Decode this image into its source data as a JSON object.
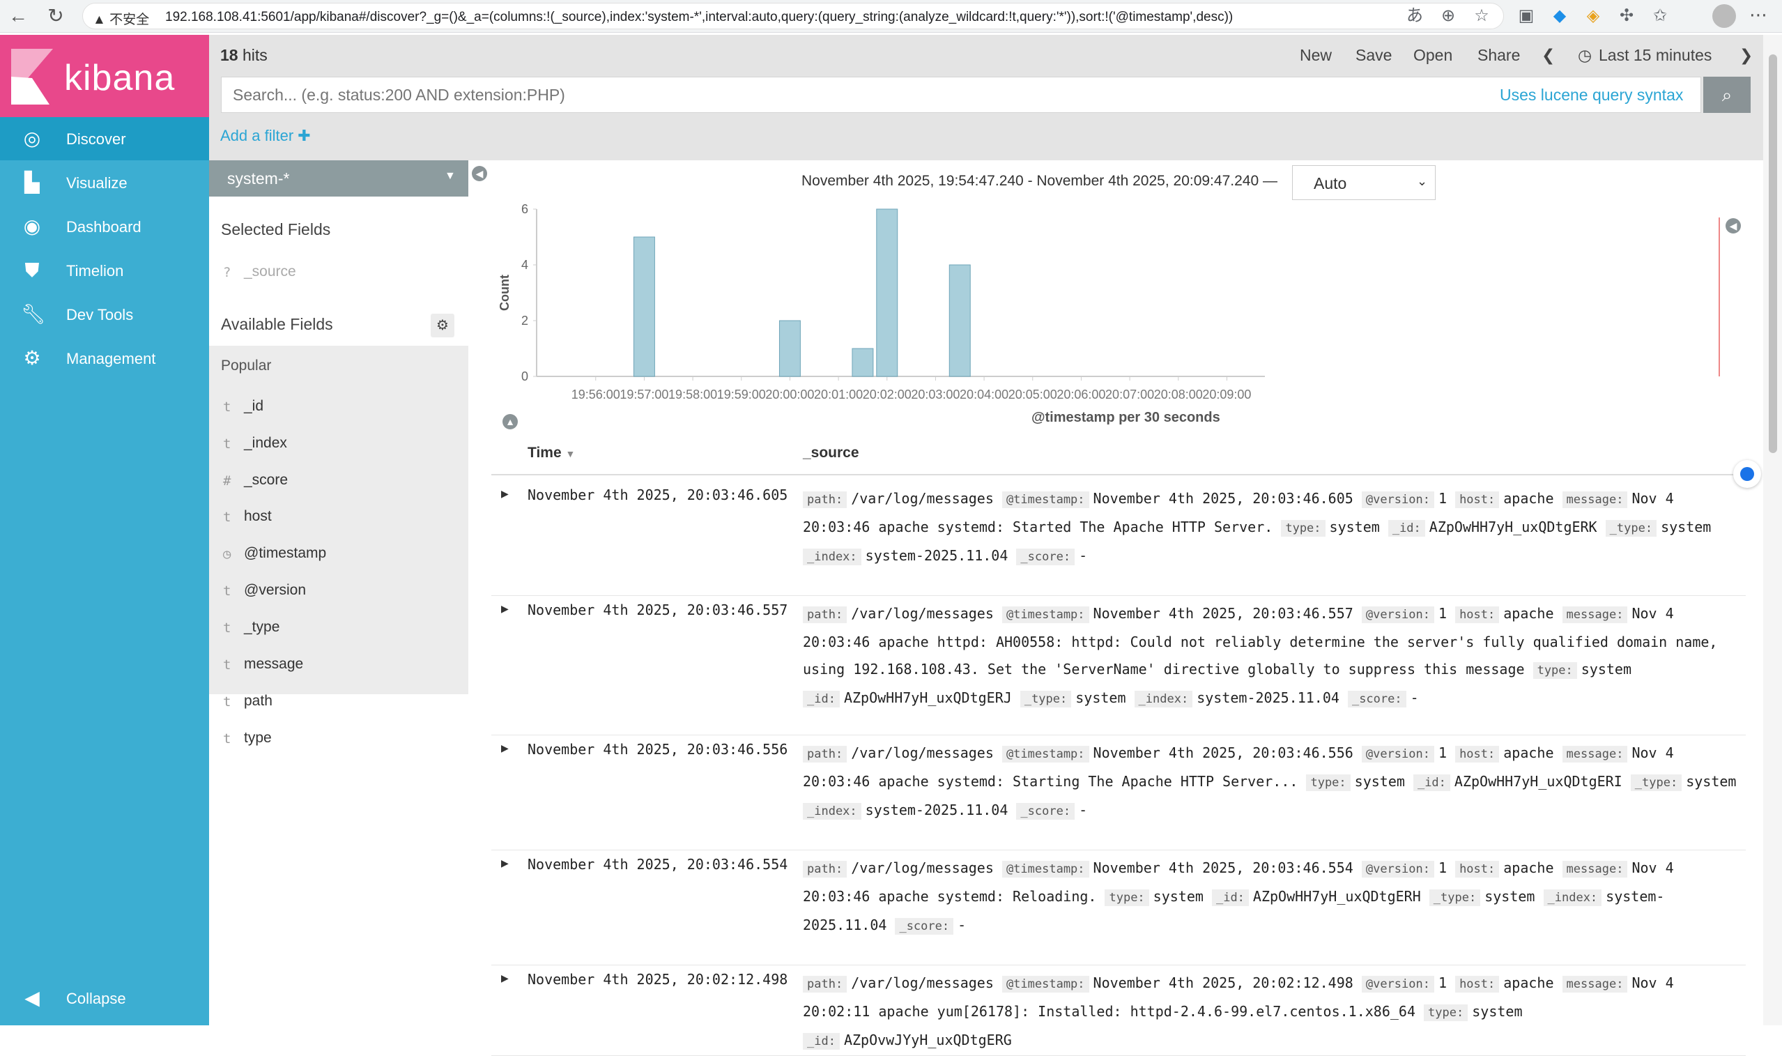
{
  "browser": {
    "insecure_label": "不安全",
    "url": "192.168.108.41:5601/app/kibana#/discover?_g=()&_a=(columns:!(_source),index:'system-*',interval:auto,query:(query_string:(analyze_wildcard:!t,query:'*')),sort:!('@timestamp',desc))"
  },
  "sidebar": {
    "brand": "kibana",
    "items": [
      {
        "label": "Discover",
        "icon": "compass-icon"
      },
      {
        "label": "Visualize",
        "icon": "bar-chart-icon"
      },
      {
        "label": "Dashboard",
        "icon": "dashboard-icon"
      },
      {
        "label": "Timelion",
        "icon": "shield-icon"
      },
      {
        "label": "Dev Tools",
        "icon": "wrench-icon"
      },
      {
        "label": "Management",
        "icon": "gear-icon"
      }
    ],
    "collapse": "Collapse"
  },
  "topbar": {
    "hits_count": "18",
    "hits_label": "hits",
    "new": "New",
    "save": "Save",
    "open": "Open",
    "share": "Share",
    "timepicker": "Last 15 minutes"
  },
  "search": {
    "placeholder": "Search... (e.g. status:200 AND extension:PHP)",
    "lucene_link": "Uses lucene query syntax"
  },
  "filter": {
    "add": "Add a filter"
  },
  "fields": {
    "index_pattern": "system-*",
    "selected_title": "Selected Fields",
    "selected": [
      {
        "type": "?",
        "name": "_source"
      }
    ],
    "available_title": "Available Fields",
    "popular_label": "Popular",
    "popular": [
      {
        "type": "t",
        "name": "_id"
      },
      {
        "type": "t",
        "name": "_index"
      },
      {
        "type": "#",
        "name": "_score"
      },
      {
        "type": "t",
        "name": "host"
      }
    ],
    "others": [
      {
        "type": "◷",
        "name": "@timestamp"
      },
      {
        "type": "t",
        "name": "@version"
      },
      {
        "type": "t",
        "name": "_type"
      },
      {
        "type": "t",
        "name": "message"
      },
      {
        "type": "t",
        "name": "path"
      },
      {
        "type": "t",
        "name": "type"
      }
    ]
  },
  "histogram": {
    "range_text": "November 4th 2025, 19:54:47.240 - November 4th 2025, 20:09:47.240 —",
    "interval": "Auto"
  },
  "chart_data": {
    "type": "bar",
    "ylabel": "Count",
    "xlabel": "@timestamp per 30 seconds",
    "ylim": [
      0,
      6
    ],
    "yticks": [
      0,
      2,
      4,
      6
    ],
    "xticks": [
      "19:56:00",
      "19:57:00",
      "19:58:00",
      "19:59:00",
      "20:00:00",
      "20:01:00",
      "20:02:00",
      "20:03:00",
      "20:04:00",
      "20:05:00",
      "20:06:00",
      "20:07:00",
      "20:08:00",
      "20:09:00"
    ],
    "x_range": [
      "19:54:47",
      "20:09:47"
    ],
    "points": [
      {
        "x": "19:57:00",
        "y": 5
      },
      {
        "x": "20:00:00",
        "y": 2
      },
      {
        "x": "20:01:30",
        "y": 1
      },
      {
        "x": "20:02:00",
        "y": 6
      },
      {
        "x": "20:03:30",
        "y": 4
      }
    ],
    "color": "#a9cfdb",
    "grid": false
  },
  "table": {
    "col_time": "Time",
    "col_source": "_source",
    "rows": [
      {
        "time": "November 4th 2025, 20:03:46.605",
        "fields": [
          [
            "path:",
            "/var/log/messages"
          ],
          [
            "@timestamp:",
            "November 4th 2025, 20:03:46.605"
          ],
          [
            "@version:",
            "1"
          ],
          [
            "host:",
            "apache"
          ],
          [
            "message:",
            "Nov 4 20:03:46 apache systemd: Started The Apache HTTP Server."
          ],
          [
            "type:",
            "system"
          ],
          [
            "_id:",
            "AZpOwHH7yH_uxQDtgERK"
          ],
          [
            "_type:",
            "system"
          ],
          [
            "_index:",
            "system-2025.11.04"
          ],
          [
            "_score:",
            "-"
          ]
        ]
      },
      {
        "time": "November 4th 2025, 20:03:46.557",
        "fields": [
          [
            "path:",
            "/var/log/messages"
          ],
          [
            "@timestamp:",
            "November 4th 2025, 20:03:46.557"
          ],
          [
            "@version:",
            "1"
          ],
          [
            "host:",
            "apache"
          ],
          [
            "message:",
            "Nov 4 20:03:46 apache httpd: AH00558: httpd: Could not reliably determine the server's fully qualified domain name, using 192.168.108.43. Set the 'ServerName' directive globally to suppress this message"
          ],
          [
            "type:",
            "system"
          ],
          [
            "_id:",
            "AZpOwHH7yH_uxQDtgERJ"
          ],
          [
            "_type:",
            "system"
          ],
          [
            "_index:",
            "system-2025.11.04"
          ],
          [
            "_score:",
            "-"
          ]
        ]
      },
      {
        "time": "November 4th 2025, 20:03:46.556",
        "fields": [
          [
            "path:",
            "/var/log/messages"
          ],
          [
            "@timestamp:",
            "November 4th 2025, 20:03:46.556"
          ],
          [
            "@version:",
            "1"
          ],
          [
            "host:",
            "apache"
          ],
          [
            "message:",
            "Nov 4 20:03:46 apache systemd: Starting The Apache HTTP Server..."
          ],
          [
            "type:",
            "system"
          ],
          [
            "_id:",
            "AZpOwHH7yH_uxQDtgERI"
          ],
          [
            "_type:",
            "system"
          ],
          [
            "_index:",
            "system-2025.11.04"
          ],
          [
            "_score:",
            "-"
          ]
        ]
      },
      {
        "time": "November 4th 2025, 20:03:46.554",
        "fields": [
          [
            "path:",
            "/var/log/messages"
          ],
          [
            "@timestamp:",
            "November 4th 2025, 20:03:46.554"
          ],
          [
            "@version:",
            "1"
          ],
          [
            "host:",
            "apache"
          ],
          [
            "message:",
            "Nov 4 20:03:46 apache systemd: Reloading."
          ],
          [
            "type:",
            "system"
          ],
          [
            "_id:",
            "AZpOwHH7yH_uxQDtgERH"
          ],
          [
            "_type:",
            "system"
          ],
          [
            "_index:",
            "system-2025.11.04"
          ],
          [
            "_score:",
            "-"
          ]
        ]
      },
      {
        "time": "November 4th 2025, 20:02:12.498",
        "fields": [
          [
            "path:",
            "/var/log/messages"
          ],
          [
            "@timestamp:",
            "November 4th 2025, 20:02:12.498"
          ],
          [
            "@version:",
            "1"
          ],
          [
            "host:",
            "apache"
          ],
          [
            "message:",
            "Nov 4 20:02:11 apache yum[26178]: Installed: httpd-2.4.6-99.el7.centos.1.x86_64"
          ],
          [
            "type:",
            "system"
          ],
          [
            "_id:",
            "AZpOvwJYyH_uxQDtgERG"
          ]
        ]
      }
    ]
  }
}
